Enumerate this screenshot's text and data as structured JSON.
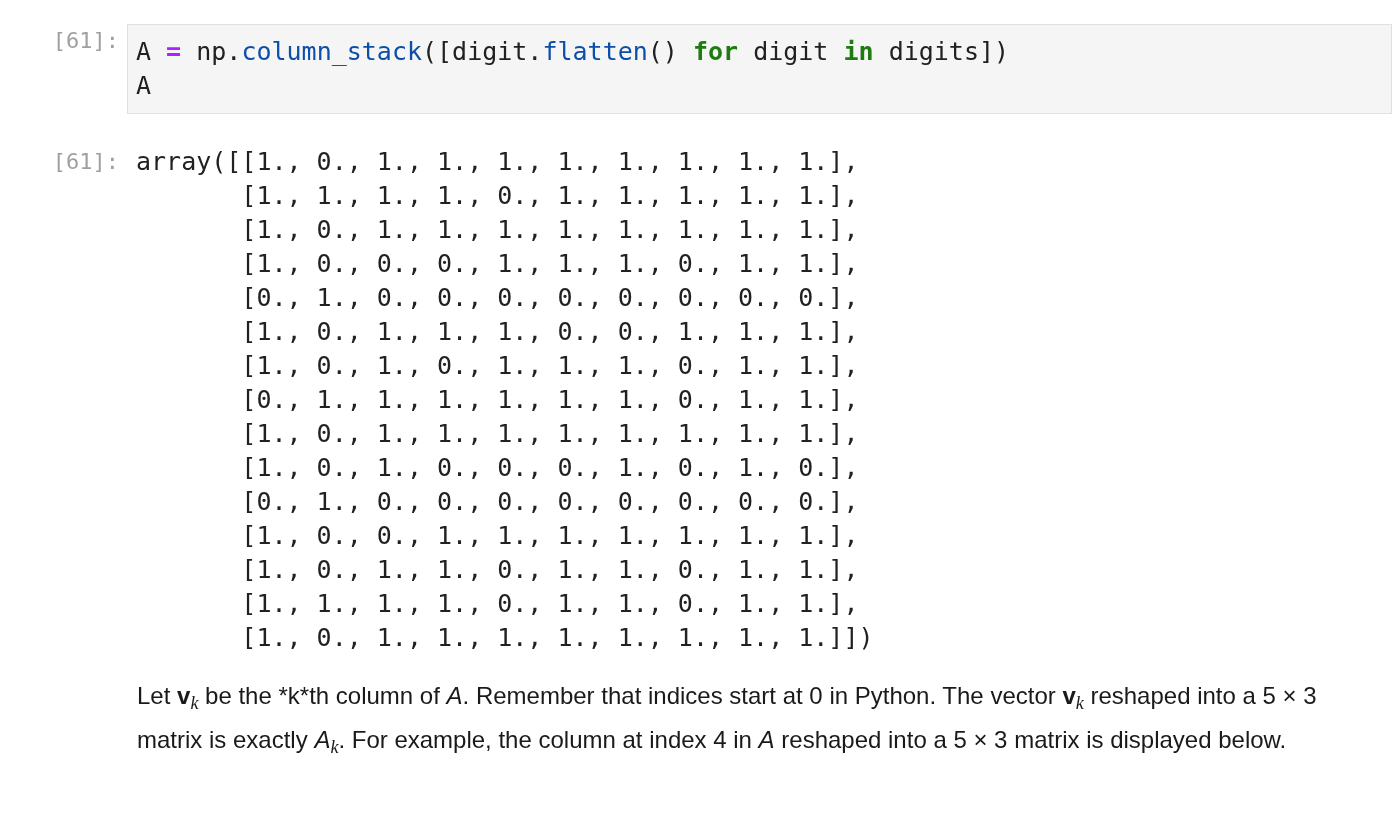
{
  "cells": [
    {
      "kind": "code",
      "prompt": "[61]:",
      "lines": [
        [
          {
            "text": "A ",
            "kind": "plain"
          },
          {
            "text": "=",
            "kind": "op"
          },
          {
            "text": " np.",
            "kind": "plain"
          },
          {
            "text": "column_stack",
            "kind": "attr"
          },
          {
            "text": "([digit.",
            "kind": "plain"
          },
          {
            "text": "flatten",
            "kind": "attr"
          },
          {
            "text": "() ",
            "kind": "plain"
          },
          {
            "text": "for",
            "kind": "keyword"
          },
          {
            "text": " digit ",
            "kind": "plain"
          },
          {
            "text": "in",
            "kind": "keyword"
          },
          {
            "text": " digits])",
            "kind": "plain"
          }
        ],
        [
          {
            "text": "A",
            "kind": "plain"
          }
        ]
      ]
    },
    {
      "kind": "output",
      "prompt": "[61]:",
      "lines": [
        "array([[1., 0., 1., 1., 1., 1., 1., 1., 1., 1.],",
        "       [1., 1., 1., 1., 0., 1., 1., 1., 1., 1.],",
        "       [1., 0., 1., 1., 1., 1., 1., 1., 1., 1.],",
        "       [1., 0., 0., 0., 1., 1., 1., 0., 1., 1.],",
        "       [0., 1., 0., 0., 0., 0., 0., 0., 0., 0.],",
        "       [1., 0., 1., 1., 1., 0., 0., 1., 1., 1.],",
        "       [1., 0., 1., 0., 1., 1., 1., 0., 1., 1.],",
        "       [0., 1., 1., 1., 1., 1., 1., 0., 1., 1.],",
        "       [1., 0., 1., 1., 1., 1., 1., 1., 1., 1.],",
        "       [1., 0., 1., 0., 0., 0., 1., 0., 1., 0.],",
        "       [0., 1., 0., 0., 0., 0., 0., 0., 0., 0.],",
        "       [1., 0., 0., 1., 1., 1., 1., 1., 1., 1.],",
        "       [1., 0., 1., 1., 0., 1., 1., 0., 1., 1.],",
        "       [1., 1., 1., 1., 0., 1., 1., 0., 1., 1.],",
        "       [1., 0., 1., 1., 1., 1., 1., 1., 1., 1.]])"
      ]
    },
    {
      "kind": "markdown",
      "text": "Let **v**$_{k}$ be the *k*th column of *A*. Remember that indices start at 0 in Python. The vector **v**$_{k}$ reshaped into a 5 × 3 matrix is exactly *A*$_{k}$. For example, the column at index 4 in *A* reshaped into a 5 × 3 matrix is displayed below."
    }
  ]
}
